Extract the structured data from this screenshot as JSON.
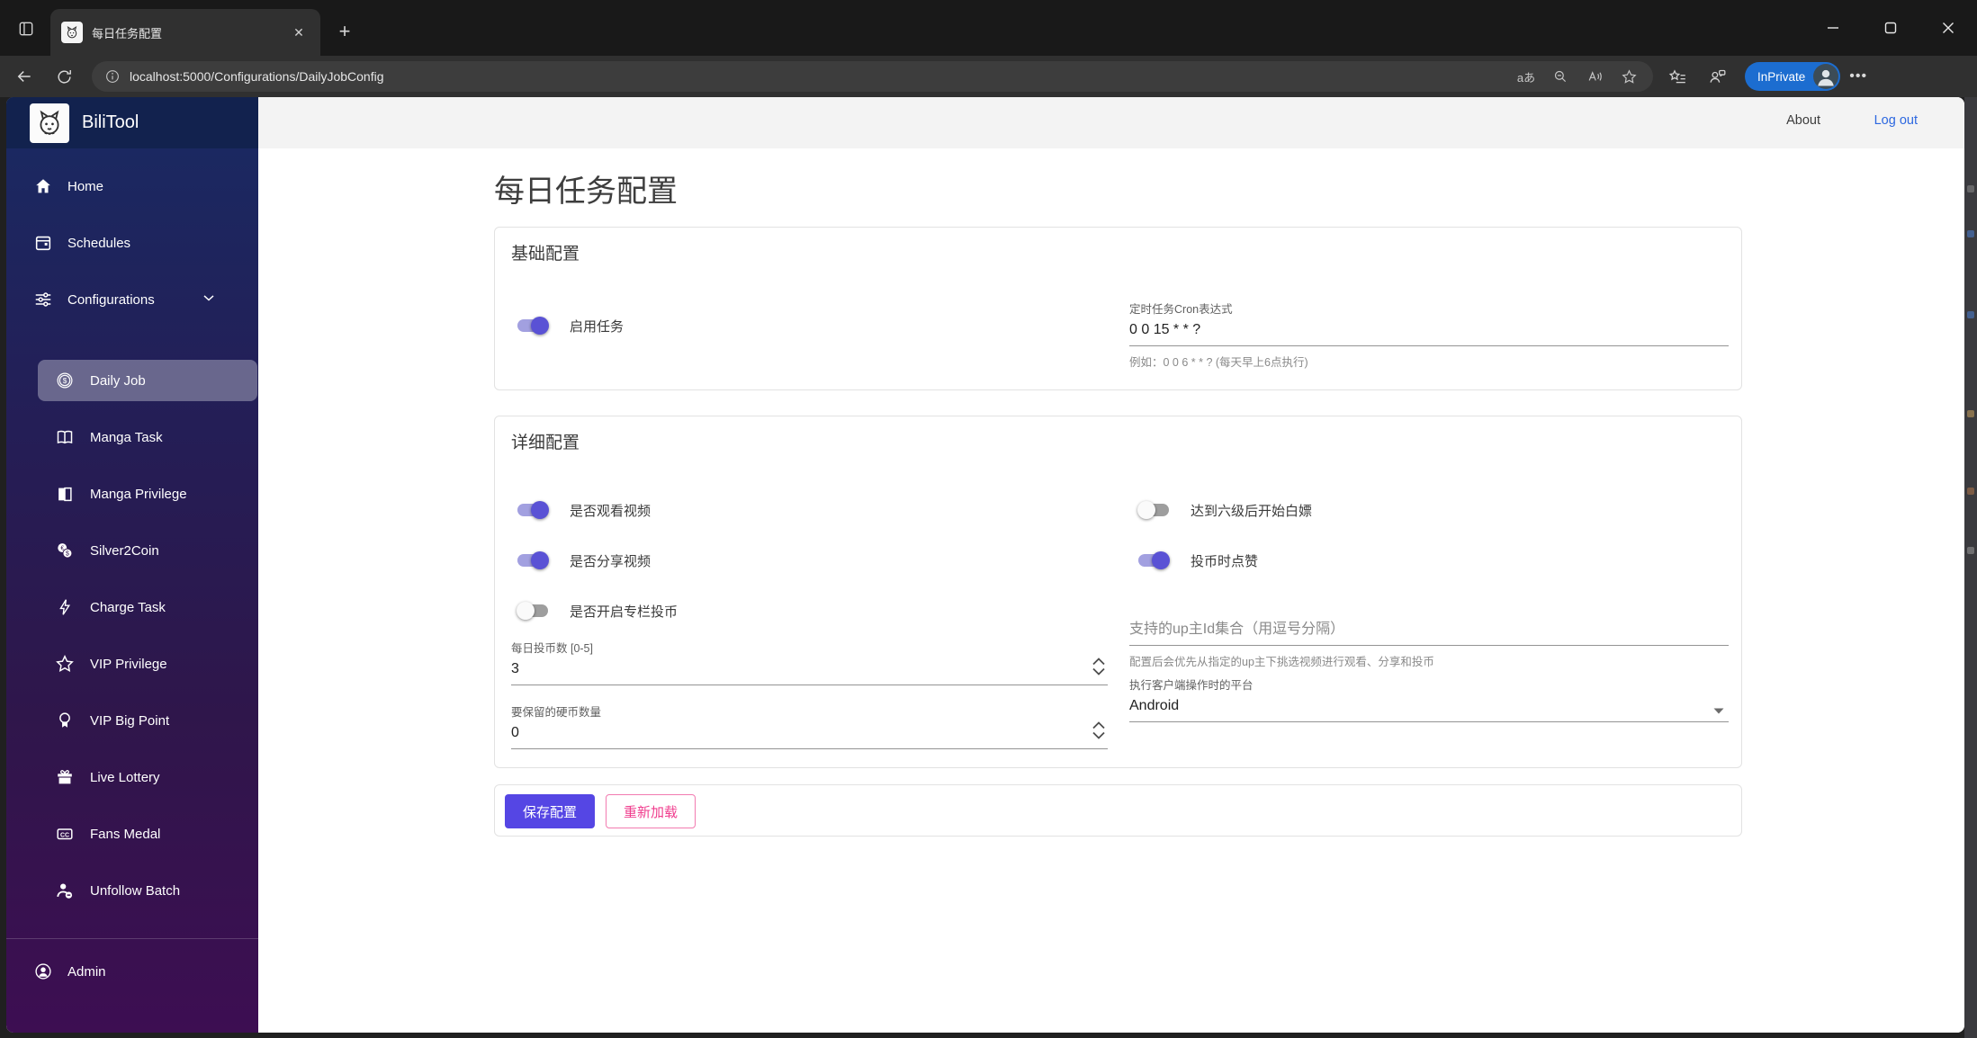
{
  "browser": {
    "tab_title": "每日任务配置",
    "url": "localhost:5000/Configurations/DailyJobConfig",
    "inprivate_label": "InPrivate",
    "translate_glyph": "aあ"
  },
  "app_header": {
    "about": "About",
    "logout": "Log out"
  },
  "sidebar": {
    "brand": "BiliTool",
    "items": [
      {
        "label": "Home",
        "icon": "home-icon"
      },
      {
        "label": "Schedules",
        "icon": "calendar-icon"
      },
      {
        "label": "Configurations",
        "icon": "sliders-icon"
      }
    ],
    "sub_items": [
      {
        "label": "Daily Job",
        "icon": "coin-icon",
        "selected": true
      },
      {
        "label": "Manga Task",
        "icon": "open-book-icon"
      },
      {
        "label": "Manga Privilege",
        "icon": "book-icon"
      },
      {
        "label": "Silver2Coin",
        "icon": "coins-icon"
      },
      {
        "label": "Charge Task",
        "icon": "lightning-icon"
      },
      {
        "label": "VIP Privilege",
        "icon": "star-icon"
      },
      {
        "label": "VIP Big Point",
        "icon": "medal-icon"
      },
      {
        "label": "Live Lottery",
        "icon": "gift-icon"
      },
      {
        "label": "Fans Medal",
        "icon": "cc-badge-icon",
        "badge_text": "CC"
      },
      {
        "label": "Unfollow Batch",
        "icon": "person-remove-icon"
      }
    ],
    "admin": "Admin"
  },
  "page": {
    "title": "每日任务配置",
    "basic_section": {
      "heading": "基础配置",
      "enable_toggle": {
        "label": "启用任务",
        "on": true
      },
      "cron": {
        "label": "定时任务Cron表达式",
        "value": "0 0 15 * * ?",
        "hint": "例如：0 0 6 * * ? (每天早上6点执行)"
      }
    },
    "detail_section": {
      "heading": "详细配置",
      "toggles_left": [
        {
          "label": "是否观看视频",
          "on": true
        },
        {
          "label": "是否分享视频",
          "on": true
        },
        {
          "label": "是否开启专栏投币",
          "on": false
        }
      ],
      "toggles_right": [
        {
          "label": "达到六级后开始白嫖",
          "on": false
        },
        {
          "label": "投币时点赞",
          "on": true
        }
      ],
      "coin_count": {
        "label": "每日投币数 [0-5]",
        "value": "3"
      },
      "reserve_coins": {
        "label": "要保留的硬币数量",
        "value": "0"
      },
      "up_ids": {
        "placeholder": "支持的up主Id集合（用逗号分隔）",
        "hint": "配置后会优先从指定的up主下挑选视频进行观看、分享和投币"
      },
      "platform": {
        "label": "执行客户端操作时的平台",
        "value": "Android"
      }
    },
    "actions": {
      "save": "保存配置",
      "reload": "重新加载"
    }
  },
  "colors": {
    "accent": "#5a52d5",
    "accent_track": "#a2a0e0",
    "save_button": "#5546e4",
    "pink": "#f03e8e",
    "link_blue": "#2d68e0",
    "inprivate_blue": "#1c6dd0",
    "sidebar_top": "#192a63",
    "sidebar_bottom": "#3d0e52"
  }
}
